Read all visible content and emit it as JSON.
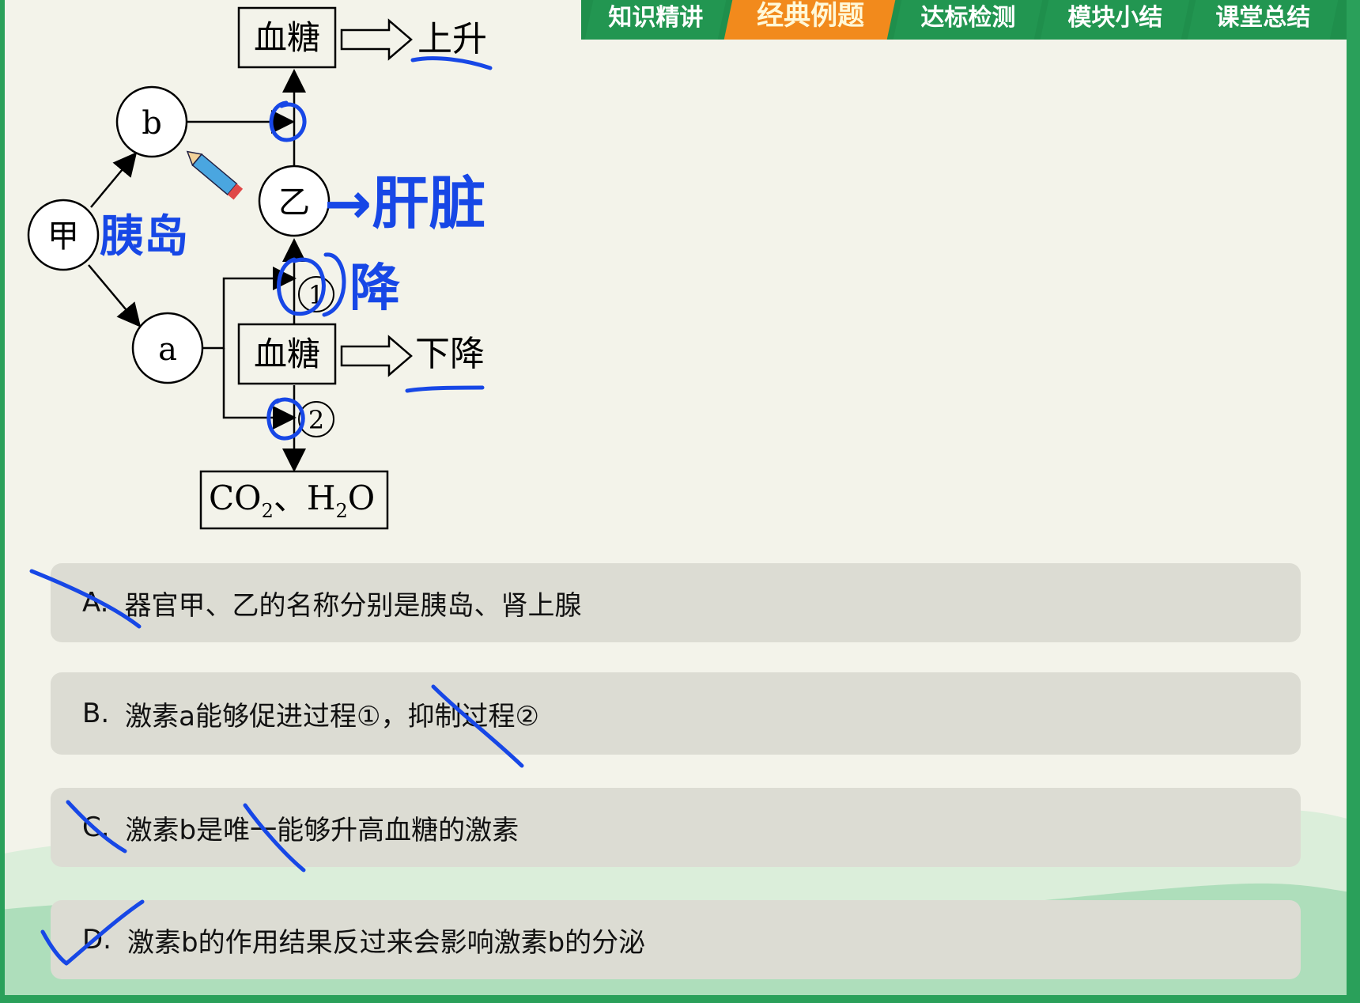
{
  "tabs": [
    {
      "label": "知识精讲"
    },
    {
      "label": "经典例题"
    },
    {
      "label": "达标检测"
    },
    {
      "label": "模块小结"
    },
    {
      "label": "课堂总结"
    }
  ],
  "active_tab": "经典例题",
  "diagram": {
    "nodes": {
      "jia": "甲",
      "yi": "乙",
      "b": "b",
      "a": "a"
    },
    "box_blood_sugar_top": "血糖",
    "box_blood_sugar_mid": "血糖",
    "result_up": "上升",
    "result_down": "下降",
    "process_1": "1",
    "process_2": "2",
    "products": {
      "co2": "CO",
      "co2_sub": "2",
      "sep": "、",
      "h2o_h": "H",
      "h2o_sub": "2",
      "h2o_o": "O"
    }
  },
  "annotations": {
    "pancreas": "胰岛",
    "liver": "→肝脏",
    "decrease": "降"
  },
  "options": [
    {
      "letter": "A.",
      "text": "器官甲、乙的名称分别是胰岛、肾上腺"
    },
    {
      "letter": "B.",
      "text": "激素a能够促进过程①，抑制过程②"
    },
    {
      "letter": "C.",
      "text": "激素b是唯一能够升高血糖的激素"
    },
    {
      "letter": "D.",
      "text": "激素b的作用结果反过来会影响激素b的分泌"
    }
  ],
  "colors": {
    "tab_green": "#229651",
    "tab_active": "#f28a1c",
    "ink_blue": "#1747e6",
    "option_bg": "#dcdcd3"
  },
  "icons": {
    "pencil": "pencil-icon"
  }
}
